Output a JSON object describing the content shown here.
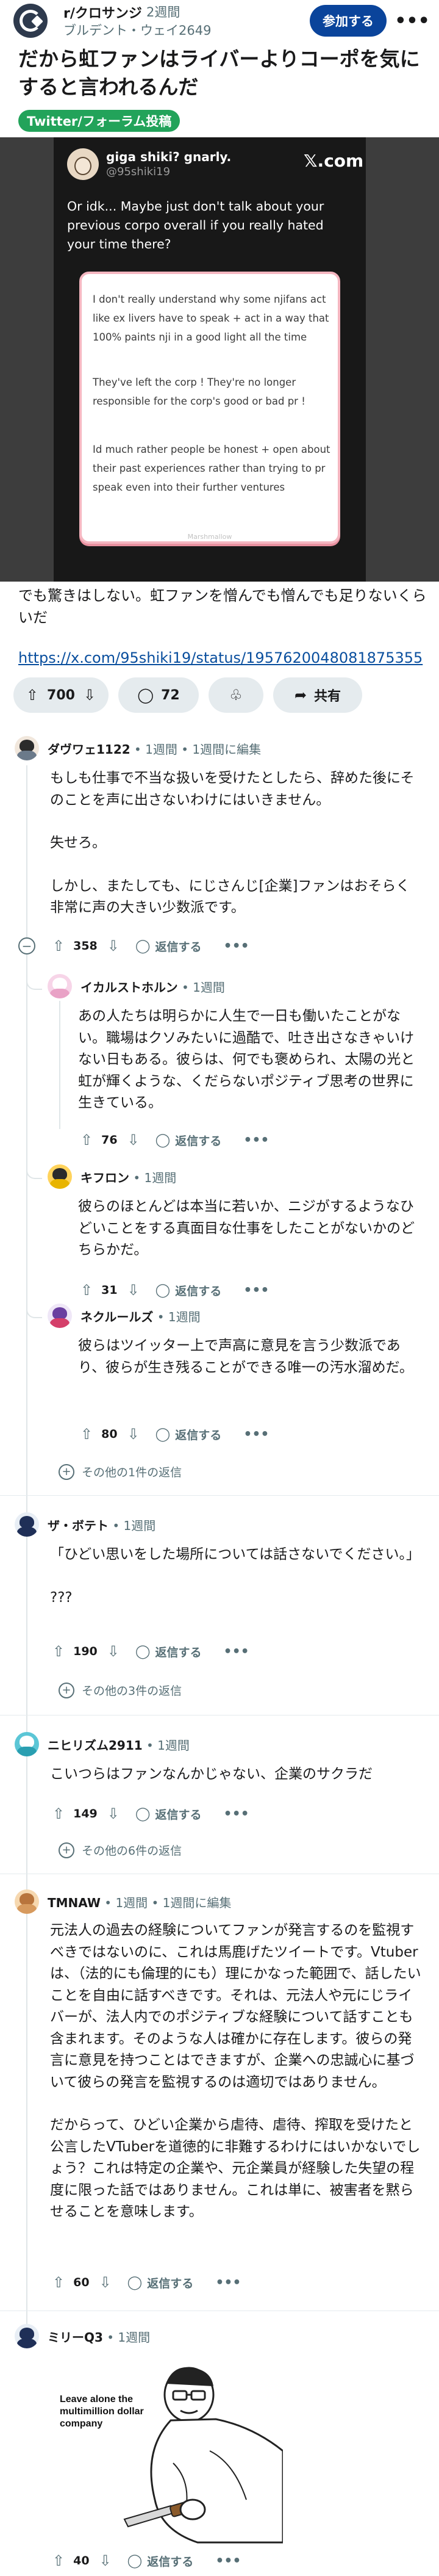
{
  "post": {
    "subreddit": "r/クロサンジ",
    "time": "2週間",
    "author": "ブルデント・ウェイ2649",
    "join_label": "参加する",
    "more_glyph": "•••",
    "title": "だから虹ファンはライバーよりコーポを気にすると言われるんだ",
    "flair": "Twitter/フォーラム投稿",
    "body": "でも驚きはしない。虹ファンを憎んでも憎んでも足りないくらいだ",
    "link": "https://x.com/95shiki19/status/1957620048081875355",
    "votes": "700",
    "comments": "72",
    "share_label": "共有"
  },
  "embed": {
    "display_name": "giga shiki? gnarly.",
    "handle": "@95shiki19",
    "logo": "𝕏.com",
    "text": "Or idk... Maybe just don't talk about your previous corpo overall if you really hated your time there?",
    "marshmallow": [
      "I don't really understand why some njifans act like ex livers have to speak + act in a way that 100% paints nji in a good light all the time",
      "They've left the corp ! They're no longer responsible for the corp's good or bad pr !",
      "Id much rather people be honest + open about their past experiences rather than trying to pr speak even into their further ventures"
    ],
    "watermark": "Marshmallow"
  },
  "comments": [
    {
      "user": "ダヴワェ1122",
      "meta": " • 1週間 • 1週間に編集",
      "paragraphs": [
        "もしも仕事で不当な扱いを受けたとしたら、辞めた後にそのことを声に出さないわけにはいきません。",
        "失せろ。",
        "しかし、またしても、にじさんじ[企業]ファンはおそらく非常に声の大きい少数派です。"
      ],
      "votes": "358",
      "reply_label": "返信する",
      "avatar_colors": [
        "#f1e7dc",
        "#2b2b2b",
        "#6b7a8a"
      ]
    },
    {
      "user": "イカルストホルン",
      "meta": " • 1週間",
      "paragraphs": [
        "あの人たちは明らかに人生で一日も働いたことがない。職場はクソみたいに過酷で、吐き出さなきゃいけない日もある。彼らは、何でも褒められ、太陽の光と虹が輝くような、くだらないポジティブ思考の世界に生きている。"
      ],
      "votes": "76",
      "reply_label": "返信する",
      "avatar_colors": [
        "#f7d5e8",
        "#ffffff",
        "#e9a2c6"
      ]
    },
    {
      "user": "キフロン",
      "meta": " • 1週間",
      "paragraphs": [
        "彼らのほとんどは本当に若いか、ニジがするようなひどいことをする真面目な仕事をしたことがないかのどちらかだ。"
      ],
      "votes": "31",
      "reply_label": "返信する",
      "avatar_colors": [
        "#ffd35c",
        "#2b2b2b",
        "#e8b400"
      ]
    },
    {
      "user": "ネクルールズ",
      "meta": " • 1週間",
      "paragraphs": [
        "彼らはツイッター上で声高に意見を言う少数派であり、彼らが生き残ることができる唯一の汚水溜めだ。"
      ],
      "votes": "80",
      "reply_label": "返信する",
      "avatar_colors": [
        "#efe7f7",
        "#6a3fa0",
        "#d43f6a"
      ]
    },
    {
      "more": "その他の1件の返信"
    },
    {
      "user": "ザ・ボテト",
      "meta": " • 1週間",
      "paragraphs": [
        "「ひどい思いをした場所については話さないでください。」",
        "???"
      ],
      "votes": "190",
      "reply_label": "返信する",
      "more": "その他の3件の返信",
      "avatar_colors": [
        "#e8eef5",
        "#1f2f57",
        "#1f2f57"
      ]
    },
    {
      "user": "ニヒリズム2911",
      "meta": " • 1週間",
      "paragraphs": [
        "こいつらはファンなんかじゃない、企業のサクラだ"
      ],
      "votes": "149",
      "reply_label": "返信する",
      "more": "その他の6件の返信",
      "avatar_colors": [
        "#5bc6d6",
        "#ffffff",
        "#2a9fb1"
      ]
    },
    {
      "user": "TMNAW",
      "meta": " • 1週間 • 1週間に編集",
      "paragraphs": [
        "元法人の過去の経験についてファンが発言するのを監視すべきではないのに、これは馬鹿げたツイートです。Vtuberは、（法的にも倫理的にも）理にかなった範囲で、話したいことを自由に話すべきです。それは、元法人や元にじライバーが、法人内でのポジティブな経験について話すことも含まれます。そのような人は確かに存在します。彼らの発言に意見を持つことはできますが、企業への忠誠心に基づいて彼らの発言を監視するのは適切ではありません。",
        "だからって、ひどい企業から虐待、虐待、搾取を受けたと公言したVTuberを道徳的に非難するわけにはいかないでしょう？これは特定の企業や、元企業員が経験した失望の程度に限った話ではありません。これは単に、被害者を黙らせることを意味します。"
      ],
      "votes": "60",
      "reply_label": "返信する",
      "avatar_colors": [
        "#f6d8b0",
        "#b8743c",
        "#d79a5e"
      ]
    },
    {
      "user": "ミリーQ3",
      "meta": " • 1週間",
      "meme_text": "Leave alone the multimillion dollar company",
      "votes": "40",
      "reply_label": "返信する",
      "avatar_colors": [
        "#e8eef5",
        "#1f2f57",
        "#1f2f57"
      ]
    }
  ],
  "icons": {
    "upvote": "⇧",
    "downvote": "⇩",
    "comment": "◯",
    "award": "♧",
    "share": "➦",
    "reply": "◯",
    "collapse": "−",
    "expand": "+"
  }
}
